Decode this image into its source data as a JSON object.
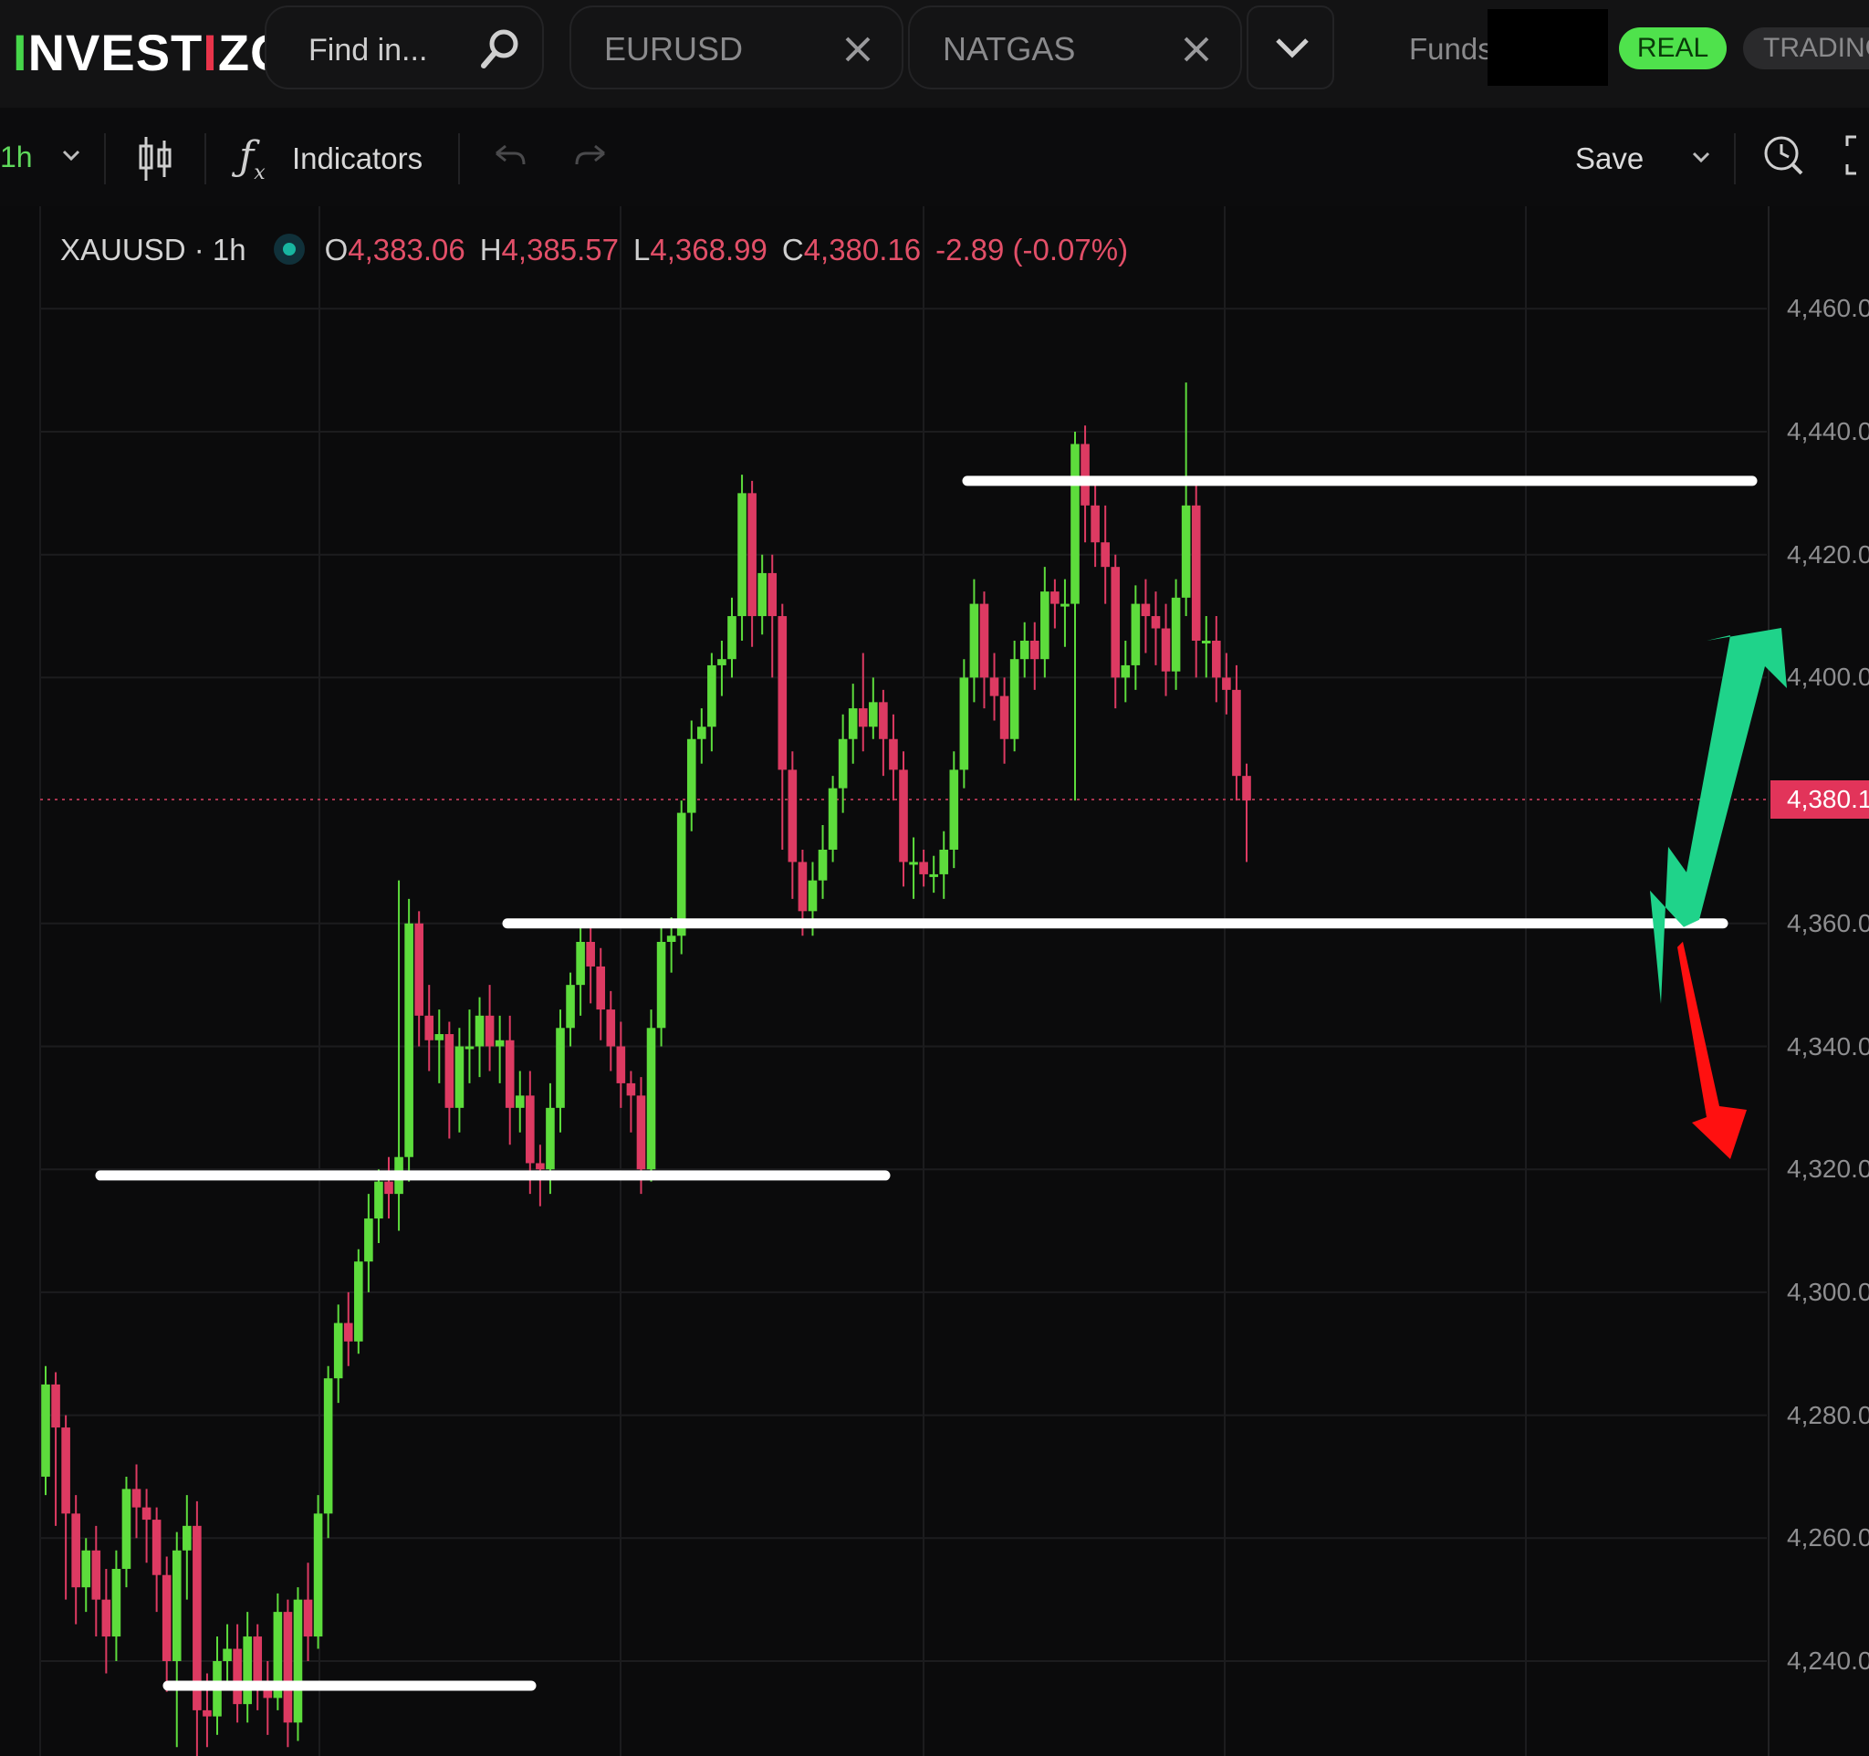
{
  "app": {
    "logo": {
      "part1": "I",
      "part2": "NVEST",
      "part3": "I",
      "part4": "ZO"
    }
  },
  "search": {
    "placeholder": "Find in..."
  },
  "tabs": [
    {
      "label": "EURUSD"
    },
    {
      "label": "NATGAS"
    }
  ],
  "account": {
    "funds_label": "Funds:",
    "real_label": "REAL",
    "trading_label": "TRADING"
  },
  "toolbar": {
    "interval": "1h",
    "indicators_label": "Indicators",
    "save_label": "Save"
  },
  "icons": {
    "search": "search-icon",
    "close": "close-icon",
    "chevron": "chevron-down-icon",
    "chart_type": "candles-icon",
    "fx": "fx-icon",
    "undo": "undo-icon",
    "redo": "redo-icon",
    "alert": "alert-clock-icon",
    "fullscreen": "fullscreen-icon"
  },
  "colors": {
    "bull": "#5ddc3c",
    "bear": "#dd3a62",
    "accent_green": "#4fe24c",
    "price_tag": "#e2345a",
    "arrow_up": "#1fd38a",
    "arrow_down": "#ff1010"
  },
  "legend": {
    "symbol": "XAUUSD · 1h",
    "o_key": "O",
    "o_val": "4,383.06",
    "h_key": "H",
    "h_val": "4,385.57",
    "l_key": "L",
    "l_val": "4,368.99",
    "c_key": "C",
    "c_val": "4,380.16",
    "change": "-2.89 (-0.07%)"
  },
  "chart_data": {
    "type": "candlestick",
    "y_range": [
      4226,
      4480
    ],
    "y_ticks": [
      {
        "value": 4460,
        "label": "4,460.0"
      },
      {
        "value": 4440,
        "label": "4,440.0"
      },
      {
        "value": 4420,
        "label": "4,420.0"
      },
      {
        "value": 4400,
        "label": "4,400.0"
      },
      {
        "value": 4380,
        "label": "4,380.1"
      },
      {
        "value": 4360,
        "label": "4,360.0"
      },
      {
        "value": 4340,
        "label": "4,340.0"
      },
      {
        "value": 4320,
        "label": "4,320.0"
      },
      {
        "value": 4300,
        "label": "4,300.0"
      },
      {
        "value": 4280,
        "label": "4,280.0"
      },
      {
        "value": 4260,
        "label": "4,260.0"
      },
      {
        "value": 4240,
        "label": "4,240.0"
      }
    ],
    "last_price": 4380.16,
    "last_price_label": "4,380.1",
    "grid": true,
    "candles": [
      [
        4270,
        4285,
        4267,
        4288
      ],
      [
        4285,
        4278,
        4262,
        4287
      ],
      [
        4278,
        4264,
        4250,
        4280
      ],
      [
        4264,
        4252,
        4246,
        4267
      ],
      [
        4252,
        4258,
        4248,
        4260
      ],
      [
        4258,
        4250,
        4244,
        4262
      ],
      [
        4250,
        4244,
        4238,
        4255
      ],
      [
        4244,
        4255,
        4240,
        4258
      ],
      [
        4255,
        4268,
        4252,
        4270
      ],
      [
        4268,
        4265,
        4260,
        4272
      ],
      [
        4265,
        4263,
        4256,
        4268
      ],
      [
        4263,
        4254,
        4248,
        4265
      ],
      [
        4254,
        4240,
        4235,
        4257
      ],
      [
        4240,
        4258,
        4226,
        4261
      ],
      [
        4258,
        4262,
        4250,
        4267
      ],
      [
        4262,
        4232,
        4222,
        4266
      ],
      [
        4232,
        4231,
        4226,
        4238
      ],
      [
        4231,
        4240,
        4228,
        4244
      ],
      [
        4240,
        4242,
        4236,
        4246
      ],
      [
        4242,
        4233,
        4230,
        4246
      ],
      [
        4233,
        4244,
        4230,
        4248
      ],
      [
        4244,
        4236,
        4232,
        4246
      ],
      [
        4236,
        4234,
        4228,
        4240
      ],
      [
        4234,
        4248,
        4232,
        4251
      ],
      [
        4248,
        4230,
        4226,
        4250
      ],
      [
        4230,
        4250,
        4227,
        4252
      ],
      [
        4250,
        4244,
        4240,
        4256
      ],
      [
        4244,
        4264,
        4242,
        4267
      ],
      [
        4264,
        4286,
        4260,
        4288
      ],
      [
        4286,
        4295,
        4282,
        4298
      ],
      [
        4295,
        4292,
        4288,
        4300
      ],
      [
        4292,
        4305,
        4290,
        4307
      ],
      [
        4305,
        4312,
        4300,
        4316
      ],
      [
        4312,
        4318,
        4308,
        4320
      ],
      [
        4318,
        4316,
        4312,
        4322
      ],
      [
        4316,
        4322,
        4310,
        4367
      ],
      [
        4322,
        4360,
        4318,
        4364
      ],
      [
        4360,
        4345,
        4340,
        4362
      ],
      [
        4345,
        4341,
        4336,
        4350
      ],
      [
        4341,
        4342,
        4334,
        4346
      ],
      [
        4342,
        4330,
        4325,
        4344
      ],
      [
        4330,
        4340,
        4326,
        4343
      ],
      [
        4340,
        4340,
        4334,
        4346
      ],
      [
        4340,
        4345,
        4335,
        4348
      ],
      [
        4345,
        4340,
        4336,
        4350
      ],
      [
        4340,
        4341,
        4334,
        4345
      ],
      [
        4341,
        4330,
        4324,
        4345
      ],
      [
        4330,
        4332,
        4326,
        4336
      ],
      [
        4332,
        4321,
        4316,
        4336
      ],
      [
        4321,
        4320,
        4314,
        4324
      ],
      [
        4320,
        4330,
        4316,
        4334
      ],
      [
        4330,
        4343,
        4326,
        4346
      ],
      [
        4343,
        4350,
        4340,
        4352
      ],
      [
        4350,
        4357,
        4345,
        4360
      ],
      [
        4357,
        4353,
        4347,
        4360
      ],
      [
        4353,
        4346,
        4341,
        4356
      ],
      [
        4346,
        4340,
        4336,
        4349
      ],
      [
        4340,
        4334,
        4330,
        4344
      ],
      [
        4334,
        4332,
        4326,
        4336
      ],
      [
        4332,
        4320,
        4316,
        4335
      ],
      [
        4320,
        4343,
        4318,
        4346
      ],
      [
        4343,
        4357,
        4340,
        4360
      ],
      [
        4357,
        4358,
        4352,
        4361
      ],
      [
        4358,
        4378,
        4355,
        4380
      ],
      [
        4378,
        4390,
        4375,
        4393
      ],
      [
        4390,
        4392,
        4386,
        4395
      ],
      [
        4392,
        4402,
        4388,
        4404
      ],
      [
        4402,
        4403,
        4397,
        4406
      ],
      [
        4403,
        4410,
        4400,
        4413
      ],
      [
        4410,
        4430,
        4406,
        4433
      ],
      [
        4430,
        4410,
        4405,
        4432
      ],
      [
        4410,
        4417,
        4407,
        4420
      ],
      [
        4417,
        4410,
        4400,
        4420
      ],
      [
        4410,
        4385,
        4372,
        4412
      ],
      [
        4385,
        4370,
        4364,
        4388
      ],
      [
        4370,
        4362,
        4358,
        4372
      ],
      [
        4362,
        4367,
        4358,
        4370
      ],
      [
        4367,
        4372,
        4364,
        4376
      ],
      [
        4372,
        4382,
        4370,
        4384
      ],
      [
        4382,
        4390,
        4378,
        4394
      ],
      [
        4390,
        4395,
        4386,
        4399
      ],
      [
        4395,
        4392,
        4388,
        4404
      ],
      [
        4392,
        4396,
        4390,
        4400
      ],
      [
        4396,
        4390,
        4384,
        4398
      ],
      [
        4390,
        4385,
        4380,
        4394
      ],
      [
        4385,
        4370,
        4366,
        4388
      ],
      [
        4370,
        4370,
        4364,
        4374
      ],
      [
        4370,
        4368,
        4366,
        4372
      ],
      [
        4368,
        4368,
        4365,
        4371
      ],
      [
        4368,
        4372,
        4364,
        4375
      ],
      [
        4372,
        4385,
        4369,
        4388
      ],
      [
        4385,
        4400,
        4382,
        4403
      ],
      [
        4400,
        4412,
        4396,
        4416
      ],
      [
        4412,
        4400,
        4395,
        4414
      ],
      [
        4400,
        4397,
        4393,
        4404
      ],
      [
        4397,
        4390,
        4386,
        4400
      ],
      [
        4390,
        4403,
        4388,
        4406
      ],
      [
        4403,
        4406,
        4400,
        4409
      ],
      [
        4406,
        4403,
        4398,
        4409
      ],
      [
        4403,
        4414,
        4400,
        4418
      ],
      [
        4414,
        4412,
        4408,
        4416
      ],
      [
        4412,
        4412,
        4405,
        4416
      ],
      [
        4412,
        4438,
        4380,
        4440
      ],
      [
        4438,
        4428,
        4422,
        4441
      ],
      [
        4428,
        4422,
        4418,
        4432
      ],
      [
        4422,
        4418,
        4412,
        4428
      ],
      [
        4418,
        4400,
        4395,
        4420
      ],
      [
        4400,
        4402,
        4396,
        4406
      ],
      [
        4402,
        4412,
        4398,
        4415
      ],
      [
        4412,
        4410,
        4404,
        4416
      ],
      [
        4410,
        4408,
        4402,
        4414
      ],
      [
        4408,
        4401,
        4397,
        4412
      ],
      [
        4401,
        4413,
        4398,
        4416
      ],
      [
        4413,
        4428,
        4410,
        4448
      ],
      [
        4428,
        4406,
        4400,
        4432
      ],
      [
        4406,
        4406,
        4400,
        4410
      ],
      [
        4406,
        4400,
        4396,
        4410
      ],
      [
        4400,
        4398,
        4394,
        4404
      ],
      [
        4398,
        4384,
        4380,
        4402
      ],
      [
        4384,
        4380,
        4370,
        4386
      ]
    ],
    "levels": [
      4236,
      4319,
      4360,
      4432
    ]
  }
}
